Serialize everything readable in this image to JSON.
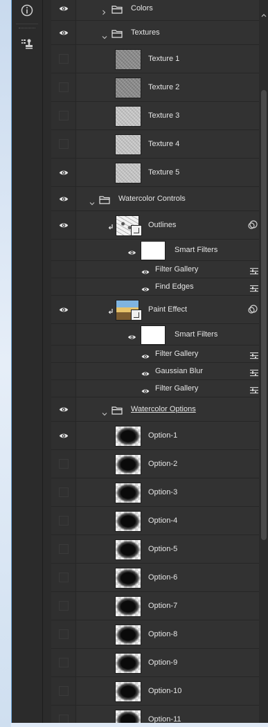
{
  "layers": [
    {
      "kind": "group",
      "label": "Colors",
      "visible": true,
      "expanded": false,
      "indent": 1
    },
    {
      "kind": "group",
      "label": "Textures",
      "visible": true,
      "expanded": true,
      "indent": 1
    },
    {
      "kind": "texture",
      "label": "Texture 1",
      "visible": false
    },
    {
      "kind": "texture",
      "label": "Texture 2",
      "visible": false
    },
    {
      "kind": "texture",
      "label": "Texture 3",
      "visible": false
    },
    {
      "kind": "texture",
      "label": "Texture 4",
      "visible": false
    },
    {
      "kind": "texture",
      "label": "Texture 5",
      "visible": true
    },
    {
      "kind": "group",
      "label": "Watercolor Controls",
      "visible": true,
      "expanded": true,
      "indent": 0
    },
    {
      "kind": "smart",
      "label": "Outlines",
      "visible": true
    },
    {
      "kind": "smartfilters",
      "label": "Smart Filters"
    },
    {
      "kind": "filter",
      "label": "Filter Gallery"
    },
    {
      "kind": "filter",
      "label": "Find Edges"
    },
    {
      "kind": "smart",
      "label": "Paint Effect",
      "visible": true
    },
    {
      "kind": "smartfilters",
      "label": "Smart Filters"
    },
    {
      "kind": "filter",
      "label": "Filter Gallery"
    },
    {
      "kind": "filter",
      "label": "Gaussian Blur"
    },
    {
      "kind": "filter",
      "label": "Filter Gallery"
    },
    {
      "kind": "group",
      "label": "Watercolor Options",
      "visible": true,
      "expanded": true,
      "indent": 1,
      "underline": true
    },
    {
      "kind": "option",
      "label": "Option-1",
      "visible": true
    },
    {
      "kind": "option",
      "label": "Option-2",
      "visible": false
    },
    {
      "kind": "option",
      "label": "Option-3",
      "visible": false
    },
    {
      "kind": "option",
      "label": "Option-4",
      "visible": false
    },
    {
      "kind": "option",
      "label": "Option-5",
      "visible": false
    },
    {
      "kind": "option",
      "label": "Option-6",
      "visible": false
    },
    {
      "kind": "option",
      "label": "Option-7",
      "visible": false
    },
    {
      "kind": "option",
      "label": "Option-8",
      "visible": false
    },
    {
      "kind": "option",
      "label": "Option-9",
      "visible": false
    },
    {
      "kind": "option",
      "label": "Option-10",
      "visible": false
    },
    {
      "kind": "option",
      "label": "Option-11",
      "visible": false
    }
  ],
  "colors": {
    "panel": "#323232",
    "text": "#e6e6e6",
    "frame": "#6fa8dc"
  },
  "icons": {
    "info": "info-icon",
    "properties": "properties-stamp-icon",
    "eye": "eye-icon",
    "folder": "folder-icon",
    "filter": "filter-options-icon",
    "clip": "clip-arrow-icon"
  }
}
